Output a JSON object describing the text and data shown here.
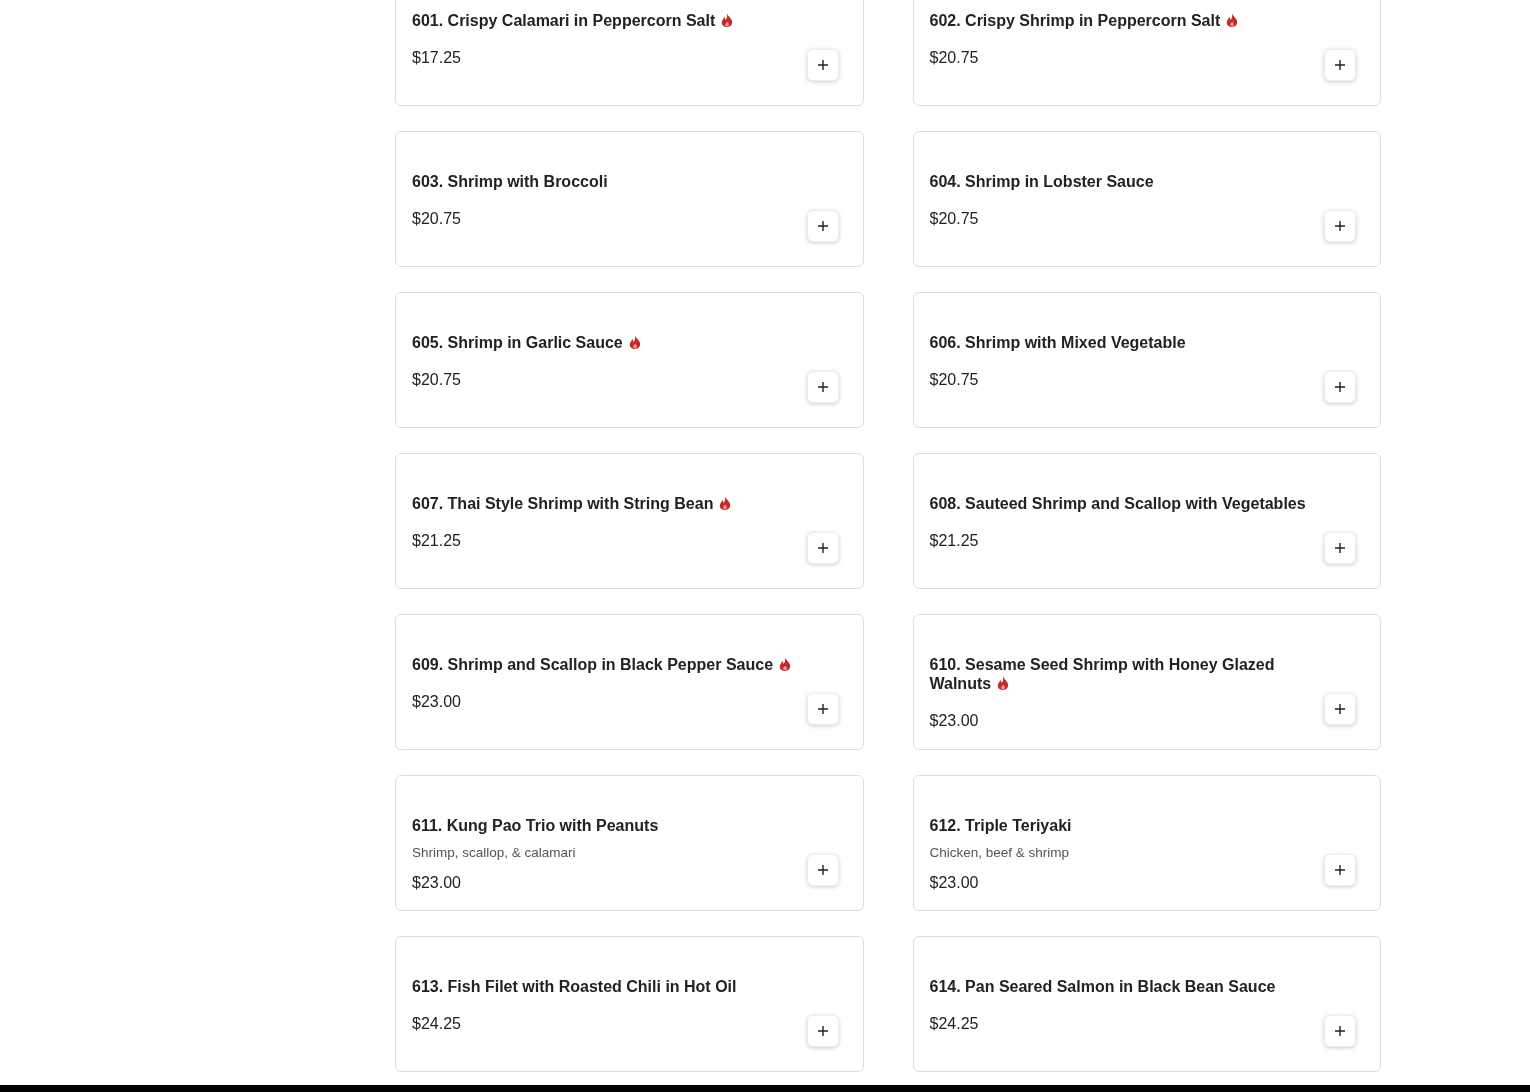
{
  "menu_items": [
    {
      "title": "601. Crispy Calamari in Peppercorn Salt",
      "spicy": true,
      "price": "$17.25"
    },
    {
      "title": "602. Crispy Shrimp in Peppercorn Salt",
      "spicy": true,
      "price": "$20.75"
    },
    {
      "title": "603. Shrimp with Broccoli",
      "spicy": false,
      "price": "$20.75"
    },
    {
      "title": "604. Shrimp in Lobster Sauce",
      "spicy": false,
      "price": "$20.75"
    },
    {
      "title": "605. Shrimp in Garlic Sauce",
      "spicy": true,
      "price": "$20.75"
    },
    {
      "title": "606. Shrimp with Mixed Vegetable",
      "spicy": false,
      "price": "$20.75"
    },
    {
      "title": "607. Thai Style Shrimp with String Bean",
      "spicy": true,
      "price": "$21.25"
    },
    {
      "title": "608. Sauteed Shrimp and Scallop with Vegetables",
      "spicy": false,
      "price": "$21.25"
    },
    {
      "title": "609. Shrimp and Scallop in Black Pepper Sauce",
      "spicy": true,
      "price": "$23.00"
    },
    {
      "title": "610. Sesame Seed Shrimp with Honey Glazed Walnuts",
      "spicy": true,
      "price": "$23.00"
    },
    {
      "title": "611. Kung Pao Trio with Peanuts",
      "description": "Shrimp, scallop, & calamari",
      "spicy": false,
      "price": "$23.00"
    },
    {
      "title": "612. Triple Teriyaki",
      "description": "Chicken, beef & shrimp",
      "spicy": false,
      "price": "$23.00"
    },
    {
      "title": "613. Fish Filet with Roasted Chili in Hot Oil",
      "spicy": false,
      "price": "$24.25"
    },
    {
      "title": "614. Pan Seared Salmon in Black Bean Sauce",
      "spicy": false,
      "price": "$24.25"
    }
  ]
}
